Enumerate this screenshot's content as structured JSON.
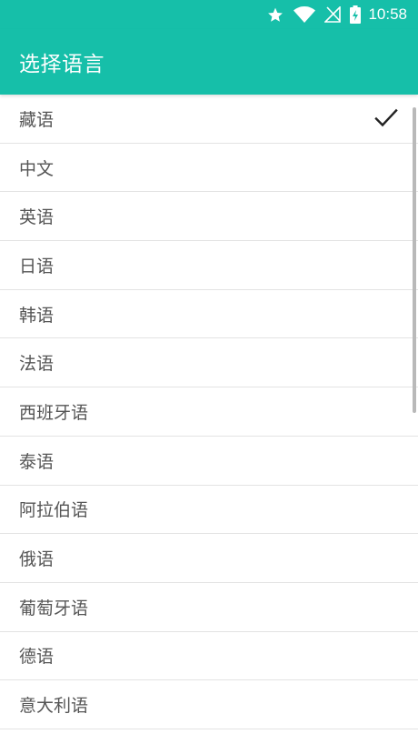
{
  "status_bar": {
    "time": "10:58",
    "icons": [
      "star-icon",
      "wifi-icon",
      "no-signal-icon",
      "battery-charging-icon"
    ]
  },
  "toolbar": {
    "title": "选择语言"
  },
  "languages": [
    {
      "label": "藏语",
      "selected": true
    },
    {
      "label": "中文",
      "selected": false
    },
    {
      "label": "英语",
      "selected": false
    },
    {
      "label": "日语",
      "selected": false
    },
    {
      "label": "韩语",
      "selected": false
    },
    {
      "label": "法语",
      "selected": false
    },
    {
      "label": "西班牙语",
      "selected": false
    },
    {
      "label": "泰语",
      "selected": false
    },
    {
      "label": "阿拉伯语",
      "selected": false
    },
    {
      "label": "俄语",
      "selected": false
    },
    {
      "label": "葡萄牙语",
      "selected": false
    },
    {
      "label": "德语",
      "selected": false
    },
    {
      "label": "意大利语",
      "selected": false
    }
  ],
  "colors": {
    "accent": "#16bfa9",
    "text": "#555555",
    "divider": "#e3e3e3"
  }
}
